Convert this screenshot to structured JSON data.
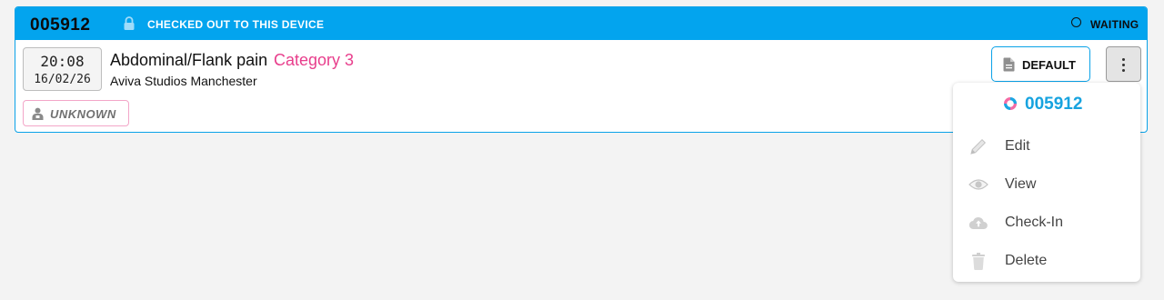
{
  "incident": {
    "id": "005912",
    "checkout_status": "CHECKED OUT TO THIS DEVICE",
    "status": "WAITING",
    "time": "20:08",
    "date": "16/02/26",
    "complaint": "Abdominal/Flank pain",
    "category": "Category 3",
    "location": "Aviva Studios Manchester",
    "patient_badge": "UNKNOWN"
  },
  "actions": {
    "default_label": "DEFAULT"
  },
  "menu": {
    "title": "005912",
    "items": [
      {
        "label": "Edit",
        "icon": "pencil-icon"
      },
      {
        "label": "View",
        "icon": "eye-icon"
      },
      {
        "label": "Check-In",
        "icon": "cloud-upload-icon"
      },
      {
        "label": "Delete",
        "icon": "trash-icon"
      }
    ]
  },
  "colors": {
    "header": "#03a4ee",
    "category": "#e83e8c",
    "menu_title": "#17a3df",
    "badge_border": "#f3a6c8"
  }
}
